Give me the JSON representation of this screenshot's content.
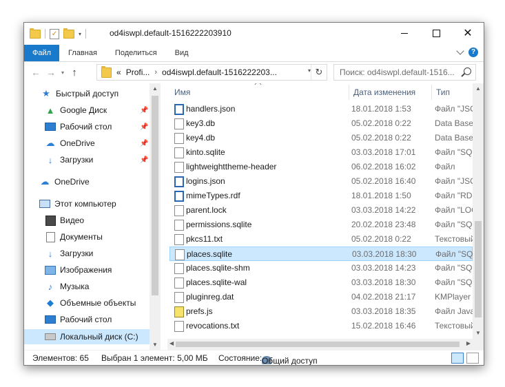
{
  "window": {
    "title": "od4iswpl.default-1516222203910",
    "controls": {
      "minimize": "",
      "maximize": "",
      "close": "✕"
    }
  },
  "ribbon": {
    "tabs": [
      "Файл",
      "Главная",
      "Поделиться",
      "Вид"
    ]
  },
  "nav": {
    "back": "←",
    "forward": "→",
    "recent": "▾",
    "up": "↑",
    "address": {
      "prefix": "«",
      "parts": [
        "Profi...",
        "od4iswpl.default-1516222203..."
      ],
      "separator": "›"
    },
    "refresh": "↻",
    "search_placeholder": "Поиск: od4iswpl.default-1516..."
  },
  "sidebar": {
    "items": [
      {
        "label": "Быстрый доступ",
        "icon": "star-icon",
        "glyph": "★"
      },
      {
        "label": "Google Диск",
        "icon": "google-drive-icon",
        "glyph": "▲"
      },
      {
        "label": "Рабочий стол",
        "icon": "desktop-icon",
        "glyph": ""
      },
      {
        "label": "OneDrive",
        "icon": "onedrive-icon",
        "glyph": "☁"
      },
      {
        "label": "Загрузки",
        "icon": "downloads-icon",
        "glyph": "↓"
      },
      {
        "label": "OneDrive",
        "icon": "onedrive-icon",
        "glyph": "☁"
      },
      {
        "label": "Этот компьютер",
        "icon": "computer-icon",
        "glyph": ""
      },
      {
        "label": "Видео",
        "icon": "video-icon",
        "glyph": ""
      },
      {
        "label": "Документы",
        "icon": "documents-icon",
        "glyph": ""
      },
      {
        "label": "Загрузки",
        "icon": "downloads-icon",
        "glyph": "↓"
      },
      {
        "label": "Изображения",
        "icon": "images-icon",
        "glyph": ""
      },
      {
        "label": "Музыка",
        "icon": "music-icon",
        "glyph": "♪"
      },
      {
        "label": "Объемные объекты",
        "icon": "3d-objects-icon",
        "glyph": "◆"
      },
      {
        "label": "Рабочий стол",
        "icon": "desktop-icon",
        "glyph": ""
      },
      {
        "label": "Локальный диск (C:)",
        "icon": "disk-icon",
        "glyph": ""
      }
    ],
    "pin": "📌"
  },
  "columns": {
    "name": "Имя",
    "date": "Дата изменения",
    "type": "Тип"
  },
  "files": [
    {
      "name": "handlers.json",
      "date": "18.01.2018 1:53",
      "type": "Файл \"JSON\"",
      "icon": "json"
    },
    {
      "name": "key3.db",
      "date": "05.02.2018 0:22",
      "type": "Data Base File",
      "icon": "file"
    },
    {
      "name": "key4.db",
      "date": "05.02.2018 0:22",
      "type": "Data Base File",
      "icon": "file"
    },
    {
      "name": "kinto.sqlite",
      "date": "03.03.2018 17:01",
      "type": "Файл \"SQLITE\"",
      "icon": "file"
    },
    {
      "name": "lightweighttheme-header",
      "date": "06.02.2018 16:02",
      "type": "Файл",
      "icon": "file"
    },
    {
      "name": "logins.json",
      "date": "05.02.2018 16:40",
      "type": "Файл \"JSON\"",
      "icon": "json"
    },
    {
      "name": "mimeTypes.rdf",
      "date": "18.01.2018 1:50",
      "type": "Файл \"RDF\"",
      "icon": "json"
    },
    {
      "name": "parent.lock",
      "date": "03.03.2018 14:22",
      "type": "Файл \"LOCK\"",
      "icon": "file"
    },
    {
      "name": "permissions.sqlite",
      "date": "20.02.2018 23:48",
      "type": "Файл \"SQLITE\"",
      "icon": "file"
    },
    {
      "name": "pkcs11.txt",
      "date": "05.02.2018 0:22",
      "type": "Текстовый",
      "icon": "file"
    },
    {
      "name": "places.sqlite",
      "date": "03.03.2018 18:30",
      "type": "Файл \"SQLITE\"",
      "icon": "file",
      "selected": true
    },
    {
      "name": "places.sqlite-shm",
      "date": "03.03.2018 14:23",
      "type": "Файл \"SQLITE\"",
      "icon": "file"
    },
    {
      "name": "places.sqlite-wal",
      "date": "03.03.2018 18:30",
      "type": "Файл \"SQLITE\"",
      "icon": "file"
    },
    {
      "name": "pluginreg.dat",
      "date": "04.02.2018 21:17",
      "type": "KMPlayer",
      "icon": "file"
    },
    {
      "name": "prefs.js",
      "date": "03.03.2018 18:35",
      "type": "Файл JavaScript",
      "icon": "js"
    },
    {
      "name": "revocations.txt",
      "date": "15.02.2018 16:46",
      "type": "Текстовый",
      "icon": "file"
    }
  ],
  "status": {
    "items_count": "Элементов: 65",
    "selected": "Выбран 1 элемент: 5,00 МБ",
    "state_label": "Состояние:",
    "state_value": "Общий доступ"
  },
  "colors": {
    "accent": "#1979ca",
    "selection": "#cce8ff",
    "selection_border": "#99d1ff"
  }
}
